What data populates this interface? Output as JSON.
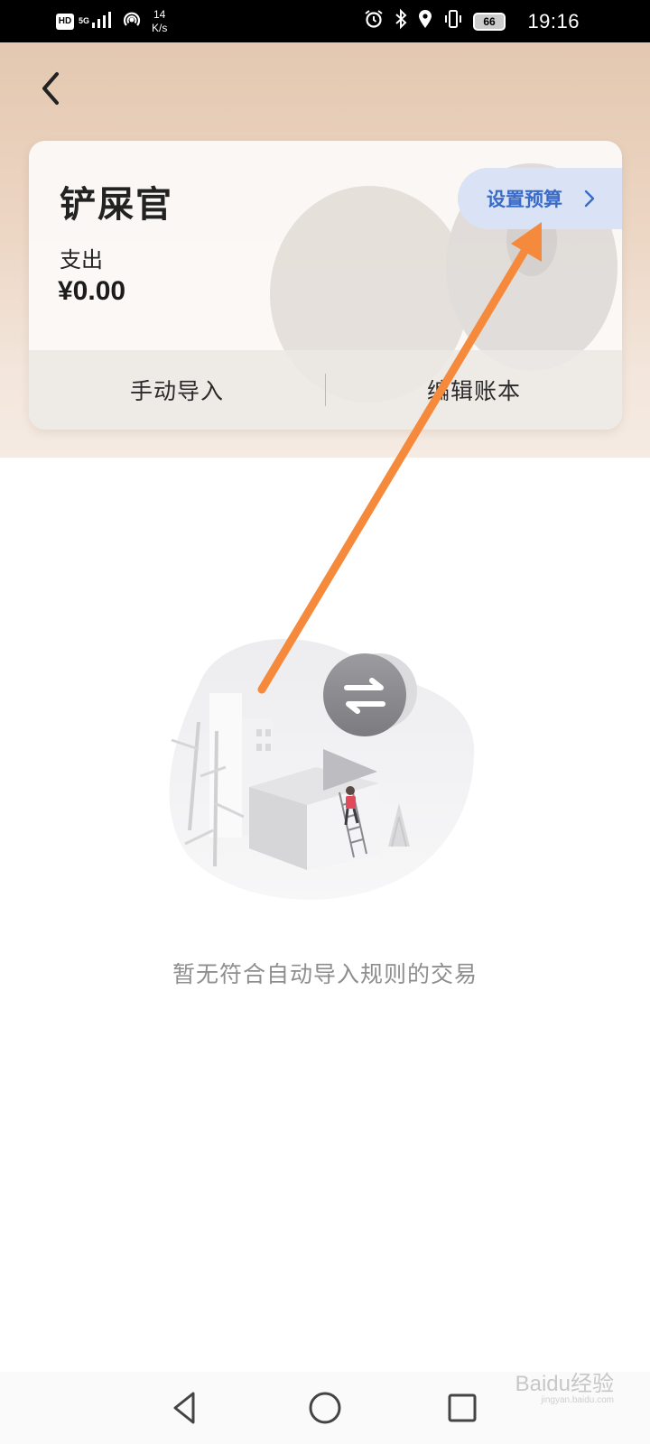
{
  "status_bar": {
    "hd": "HD",
    "network": "5G",
    "net_speed_value": "14",
    "net_speed_unit": "K/s",
    "battery": "66",
    "time": "19:16"
  },
  "header": {
    "back_icon": "chevron-left-icon"
  },
  "book_card": {
    "name": "铲屎官",
    "expense_label": "支出",
    "expense_value": "¥0.00",
    "budget_button": "设置预算",
    "actions": [
      "手动导入",
      "编辑账本"
    ]
  },
  "empty_state": {
    "message": "暂无符合自动导入规则的交易"
  },
  "annotation": {
    "arrow_color": "#f68a3c"
  },
  "nav_bar": {
    "buttons": [
      "back-triangle-icon",
      "home-circle-icon",
      "recents-square-icon"
    ]
  },
  "watermark": {
    "brand": "Baidu经验",
    "url": "jingyan.baidu.com"
  },
  "colors": {
    "accent_blue": "#3a6bc6",
    "budget_bg": "#d9e3f5",
    "header_bg": "#e4c8b0"
  }
}
